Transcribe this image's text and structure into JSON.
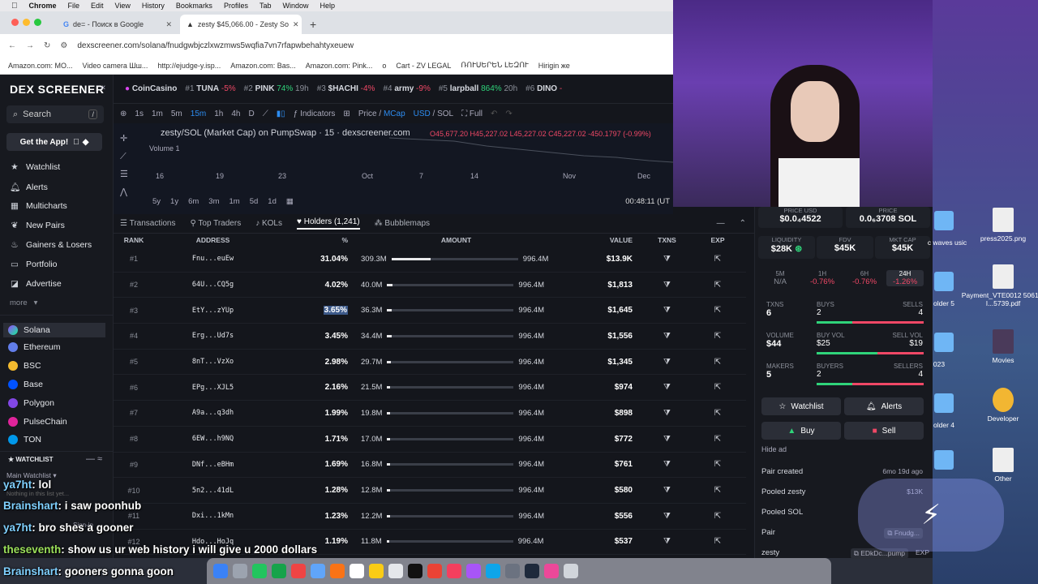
{
  "menubar": {
    "app": "Chrome",
    "items": [
      "File",
      "Edit",
      "View",
      "History",
      "Bookmarks",
      "Profiles",
      "Tab",
      "Window",
      "Help"
    ]
  },
  "tabs": [
    {
      "title": "de= - Поиск в Google"
    },
    {
      "title": "zesty $45,066.00 - Zesty So"
    }
  ],
  "address": {
    "url": "dexscreener.com/solana/fnudgwbjczlxwzmws5wqfia7vn7rfapwbehahtyxeuew"
  },
  "bookmarks": [
    "Amazon.com: MO...",
    "Video camera Шш...",
    "http://ejudge-y.isp...",
    "Amazon.com: Bas...",
    "Amazon.com: Pink...",
    "o",
    "Cart - ZV LEGAL",
    "ՌՈՒՍԵՐԵՆ ԼԵԶՈՒ",
    "Hirigin же"
  ],
  "sidebar": {
    "logo": "DEX SCREENER",
    "search": "Search",
    "search_key": "/",
    "get_app": "Get the App!",
    "nav": [
      "Watchlist",
      "Alerts",
      "Multicharts",
      "New Pairs",
      "Gainers & Losers",
      "Portfolio",
      "Advertise"
    ],
    "more": "more",
    "chains": [
      "Solana",
      "Ethereum",
      "BSC",
      "Base",
      "Polygon",
      "PulseChain",
      "TON"
    ],
    "watchlist_title": "WATCHLIST",
    "main_watchlist": "Main Watchlist",
    "empty": "Nothing in this list yet...",
    "sign_in": "Sign-in"
  },
  "ticker": [
    {
      "name": "CoinCasino",
      "rank": "",
      "chg": ""
    },
    {
      "rank": "#1",
      "name": "TUNA",
      "chg": "-5%"
    },
    {
      "rank": "#2",
      "name": "PINK",
      "chg": "74%",
      "extra": "19h"
    },
    {
      "rank": "#3",
      "name": "$HACHI",
      "chg": "-4%"
    },
    {
      "rank": "#4",
      "name": "army",
      "chg": "-9%"
    },
    {
      "rank": "#5",
      "name": "larpball",
      "chg": "864%",
      "extra": "20h"
    },
    {
      "rank": "#6",
      "name": "DINO",
      "chg": "-"
    }
  ],
  "chart_toolbar": {
    "intervals": [
      "1s",
      "1m",
      "5m",
      "15m",
      "1h",
      "4h",
      "D"
    ],
    "indicators": "Indicators",
    "price": "Price",
    "mcap": "MCap",
    "usd": "USD",
    "sol": "SOL",
    "full": "Full"
  },
  "chart": {
    "title": "zesty/SOL (Market Cap) on PumpSwap · 15 · dexscreener.com",
    "ohlc": "O45,677.20 H45,227.02 L45,227.02 C45,227.02 -450.1797 (-0.99%)",
    "volume": "Volume",
    "volume_val": "1",
    "xaxis": [
      "16",
      "19",
      "23",
      "Oct",
      "7",
      "14",
      "Nov",
      "Dec"
    ],
    "ranges": [
      "5y",
      "1y",
      "6m",
      "3m",
      "1m",
      "5d",
      "1d"
    ],
    "clock": "00:48:11 (UT"
  },
  "holders_tabs": {
    "transactions": "Transactions",
    "top_traders": "Top Traders",
    "kols": "KOLs",
    "holders": "Holders (1,241)",
    "bubblemaps": "Bubblemaps"
  },
  "table": {
    "headers": {
      "rank": "RANK",
      "address": "ADDRESS",
      "pct": "%",
      "amount": "AMOUNT",
      "value": "VALUE",
      "txns": "TXNS",
      "exp": "EXP"
    },
    "rows": [
      {
        "rank": "#1",
        "address": "Fnu...euEw",
        "pct": "31.04%",
        "amount": "309.3M",
        "total": "996.4M",
        "value": "$13.9K",
        "fill": 0.31
      },
      {
        "rank": "#2",
        "address": "64U...CQ5g",
        "pct": "4.02%",
        "amount": "40.0M",
        "total": "996.4M",
        "value": "$1,813",
        "fill": 0.04
      },
      {
        "rank": "#3",
        "address": "EtY...zYUp",
        "pct": "3.65%",
        "amount": "36.3M",
        "total": "996.4M",
        "value": "$1,645",
        "fill": 0.036
      },
      {
        "rank": "#4",
        "address": "Erg...Ud7s",
        "pct": "3.45%",
        "amount": "34.4M",
        "total": "996.4M",
        "value": "$1,556",
        "fill": 0.035
      },
      {
        "rank": "#5",
        "address": "8nT...VzXo",
        "pct": "2.98%",
        "amount": "29.7M",
        "total": "996.4M",
        "value": "$1,345",
        "fill": 0.03
      },
      {
        "rank": "#6",
        "address": "EPg...XJL5",
        "pct": "2.16%",
        "amount": "21.5M",
        "total": "996.4M",
        "value": "$974",
        "fill": 0.022
      },
      {
        "rank": "#7",
        "address": "A9a...q3dh",
        "pct": "1.99%",
        "amount": "19.8M",
        "total": "996.4M",
        "value": "$898",
        "fill": 0.02
      },
      {
        "rank": "#8",
        "address": "6EW...h9NQ",
        "pct": "1.71%",
        "amount": "17.0M",
        "total": "996.4M",
        "value": "$772",
        "fill": 0.017
      },
      {
        "rank": "#9",
        "address": "DNf...eBHm",
        "pct": "1.69%",
        "amount": "16.8M",
        "total": "996.4M",
        "value": "$761",
        "fill": 0.017
      },
      {
        "rank": "#10",
        "address": "5n2...41dL",
        "pct": "1.28%",
        "amount": "12.8M",
        "total": "996.4M",
        "value": "$580",
        "fill": 0.013
      },
      {
        "rank": "#11",
        "address": "Dxi...1kMn",
        "pct": "1.23%",
        "amount": "12.2M",
        "total": "996.4M",
        "value": "$556",
        "fill": 0.012
      },
      {
        "rank": "#12",
        "address": "Hdo...HoJq",
        "pct": "1.19%",
        "amount": "11.8M",
        "total": "996.4M",
        "value": "$537",
        "fill": 0.012
      }
    ]
  },
  "pair": {
    "price_usd_label": "PRICE USD",
    "price_usd": "$0.0₄4522",
    "price_label": "PRICE",
    "price": "0.0₆3708 SOL",
    "liq_label": "LIQUIDITY",
    "liq": "$28K",
    "fdv_label": "FDV",
    "fdv": "$45K",
    "mcap_label": "MKT CAP",
    "mcap": "$45K",
    "tf": [
      {
        "l": "5M",
        "v": "N/A"
      },
      {
        "l": "1H",
        "v": "-0.76%"
      },
      {
        "l": "6H",
        "v": "-0.76%"
      },
      {
        "l": "24H",
        "v": "-1.26%"
      }
    ],
    "txns_label": "TXNS",
    "txns": "6",
    "buys_label": "BUYS",
    "buys": "2",
    "sells_label": "SELLS",
    "sells": "4",
    "vol_label": "VOLUME",
    "vol": "$44",
    "buyvol_label": "BUY VOL",
    "buyvol": "$25",
    "sellvol_label": "SELL VOL",
    "sellvol": "$19",
    "makers_label": "MAKERS",
    "makers": "5",
    "buyers_label": "BUYERS",
    "buyers": "2",
    "sellers_label": "SELLERS",
    "sellers": "4",
    "watchlist": "Watchlist",
    "alerts": "Alerts",
    "buy": "Buy",
    "sell": "Sell",
    "hide_ad": "Hide ad",
    "pair_created": "Pair created",
    "pair_created_v": "6mo 19d ago",
    "pooled_zesty": "Pooled zesty",
    "pooled_zesty_v": "$13K",
    "pooled_sol": "Pooled SOL",
    "pair": "Pair",
    "pair_v": "Fnudg...",
    "zesty": "zesty",
    "zesty_v": "EDkDc...pump",
    "exp": "EXP"
  },
  "desktop": {
    "files": [
      "c waves\nusic",
      "press2025.png",
      "Payment_VTE0012\n50613-I...5739.pdf",
      "Movies",
      "Developer",
      "Other"
    ],
    "folders": [
      "older 5",
      "023",
      "older 4"
    ]
  },
  "chat": [
    {
      "user": "ya7ht",
      "msg": "lol"
    },
    {
      "user": "Brainshart",
      "msg": "i saw poonhub"
    },
    {
      "user": "ya7ht",
      "msg": "bro shes a gooner"
    },
    {
      "user": "theseventh",
      "msg": "show us ur web history i will give u 2000 dollars"
    },
    {
      "user": "Brainshart",
      "msg": "gooners gonna goon"
    }
  ]
}
